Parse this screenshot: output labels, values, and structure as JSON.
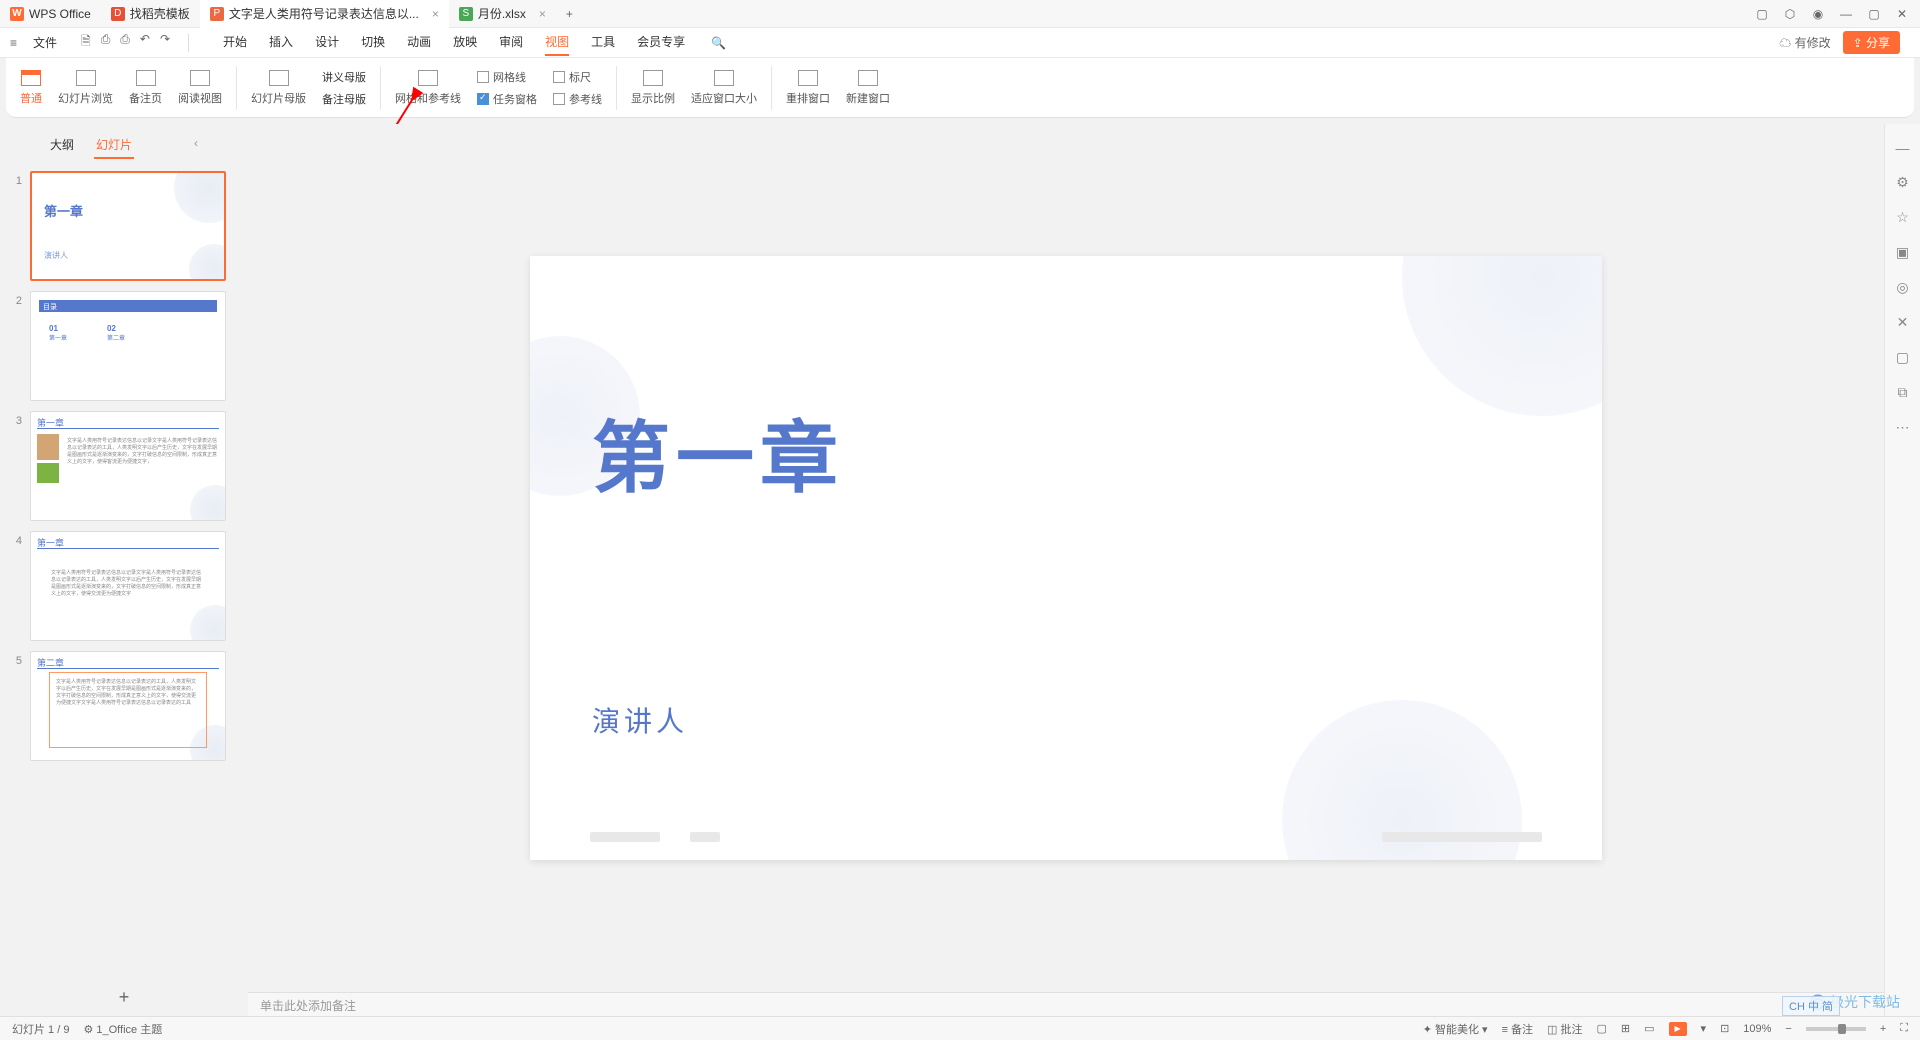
{
  "titleBar": {
    "tabs": [
      {
        "icon": "W",
        "label": "WPS Office"
      },
      {
        "icon": "D",
        "label": "找稻壳模板"
      },
      {
        "icon": "P",
        "label": "文字是人类用符号记录表达信息以..."
      },
      {
        "icon": "S",
        "label": "月份.xlsx"
      }
    ],
    "activeTab": 2
  },
  "menuRow": {
    "fileLabel": "文件",
    "tabs": [
      "开始",
      "插入",
      "设计",
      "切换",
      "动画",
      "放映",
      "审阅",
      "视图",
      "工具",
      "会员专享"
    ],
    "activeTab": "视图",
    "hasChanges": "有修改",
    "share": "分享"
  },
  "ribbon": {
    "group1": [
      {
        "label": "普通",
        "active": true
      },
      {
        "label": "幻灯片浏览"
      },
      {
        "label": "备注页"
      },
      {
        "label": "阅读视图"
      }
    ],
    "group2": [
      {
        "label": "幻灯片母版"
      },
      {
        "label": "讲义母版"
      },
      {
        "label": "备注母版"
      }
    ],
    "gridGuides": "网格和参考线",
    "checks": {
      "grid": {
        "label": "网格线",
        "checked": false
      },
      "task": {
        "label": "任务窗格",
        "checked": true
      },
      "ruler": {
        "label": "标尺",
        "checked": false
      },
      "guide": {
        "label": "参考线",
        "checked": false
      }
    },
    "group4": [
      {
        "label": "显示比例"
      },
      {
        "label": "适应窗口大小"
      }
    ],
    "group5": [
      {
        "label": "重排窗口"
      },
      {
        "label": "新建窗口"
      }
    ]
  },
  "sidePanel": {
    "tabs": [
      "大纲",
      "幻灯片"
    ],
    "activeTab": "幻灯片",
    "slides": [
      {
        "num": "1",
        "title": "第一章",
        "sub": "演讲人"
      },
      {
        "num": "2",
        "bar": "目录",
        "c01": "01",
        "c01s": "第一章",
        "c02": "02",
        "c02s": "第二章"
      },
      {
        "num": "3",
        "head": "第一章"
      },
      {
        "num": "4",
        "head": "第一章"
      },
      {
        "num": "5",
        "head": "第二章"
      }
    ]
  },
  "slide": {
    "title": "第一章",
    "subtitle": "演讲人"
  },
  "notesPlaceholder": "单击此处添加备注",
  "statusBar": {
    "slideCount": "幻灯片 1 / 9",
    "theme": "1_Office 主题",
    "beautify": "智能美化",
    "notes": "备注",
    "comments": "批注",
    "zoom": "109%"
  },
  "watermark": "极光下载站",
  "ime": "CH 中 简"
}
